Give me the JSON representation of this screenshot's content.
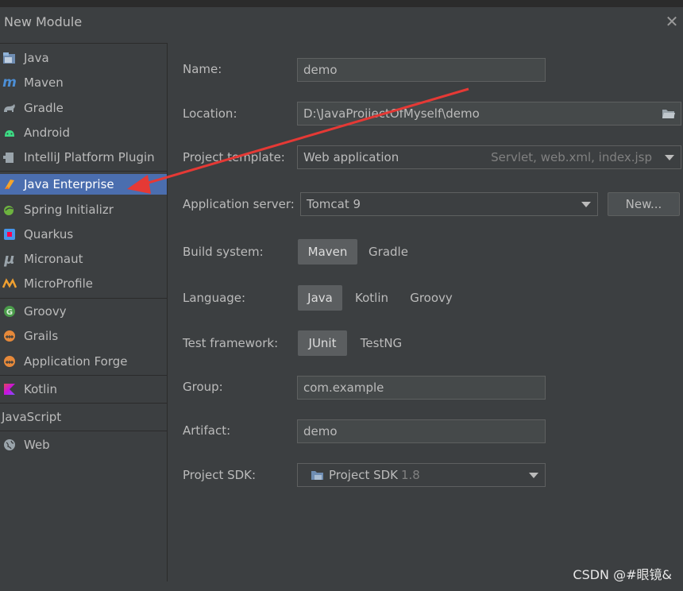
{
  "dialog": {
    "title": "New Module"
  },
  "sidebar": {
    "items": [
      {
        "label": "Java",
        "icon": "java-folder-icon"
      },
      {
        "label": "Maven",
        "icon": "maven-icon"
      },
      {
        "label": "Gradle",
        "icon": "gradle-icon"
      },
      {
        "label": "Android",
        "icon": "android-icon"
      },
      {
        "label": "IntelliJ Platform Plugin",
        "icon": "plugin-icon"
      },
      {
        "label": "Java Enterprise",
        "icon": "java-enterprise-icon",
        "selected": true
      },
      {
        "label": "Spring Initializr",
        "icon": "spring-icon"
      },
      {
        "label": "Quarkus",
        "icon": "quarkus-icon"
      },
      {
        "label": "Micronaut",
        "icon": "micronaut-icon"
      },
      {
        "label": "MicroProfile",
        "icon": "microprofile-icon"
      },
      {
        "label": "Groovy",
        "icon": "groovy-icon"
      },
      {
        "label": "Grails",
        "icon": "grails-icon"
      },
      {
        "label": "Application Forge",
        "icon": "application-forge-icon"
      },
      {
        "label": "Kotlin",
        "icon": "kotlin-icon"
      },
      {
        "label": "JavaScript",
        "icon": ""
      },
      {
        "label": "Web",
        "icon": "web-globe-icon"
      }
    ]
  },
  "form": {
    "name_label": "Name:",
    "name_value": "demo",
    "location_label": "Location:",
    "location_value": "D:\\JavaProjiectOfMyself\\demo",
    "template_label": "Project template:",
    "template_value": "Web application",
    "template_hint": "Servlet, web.xml, index.jsp",
    "server_label": "Application server:",
    "server_value": "Tomcat 9",
    "new_button": "New...",
    "build_label": "Build system:",
    "build_options": [
      "Maven",
      "Gradle"
    ],
    "build_selected": "Maven",
    "language_label": "Language:",
    "language_options": [
      "Java",
      "Kotlin",
      "Groovy"
    ],
    "language_selected": "Java",
    "test_label": "Test framework:",
    "test_options": [
      "JUnit",
      "TestNG"
    ],
    "test_selected": "JUnit",
    "group_label": "Group:",
    "group_value": "com.example",
    "artifact_label": "Artifact:",
    "artifact_value": "demo",
    "sdk_label": "Project SDK:",
    "sdk_value": "Project SDK",
    "sdk_version": "1.8"
  },
  "watermark": "CSDN @#眼镜&",
  "colors": {
    "background": "#3c3f41",
    "selection": "#4b6eaf",
    "annotation_arrow": "#e53935"
  }
}
